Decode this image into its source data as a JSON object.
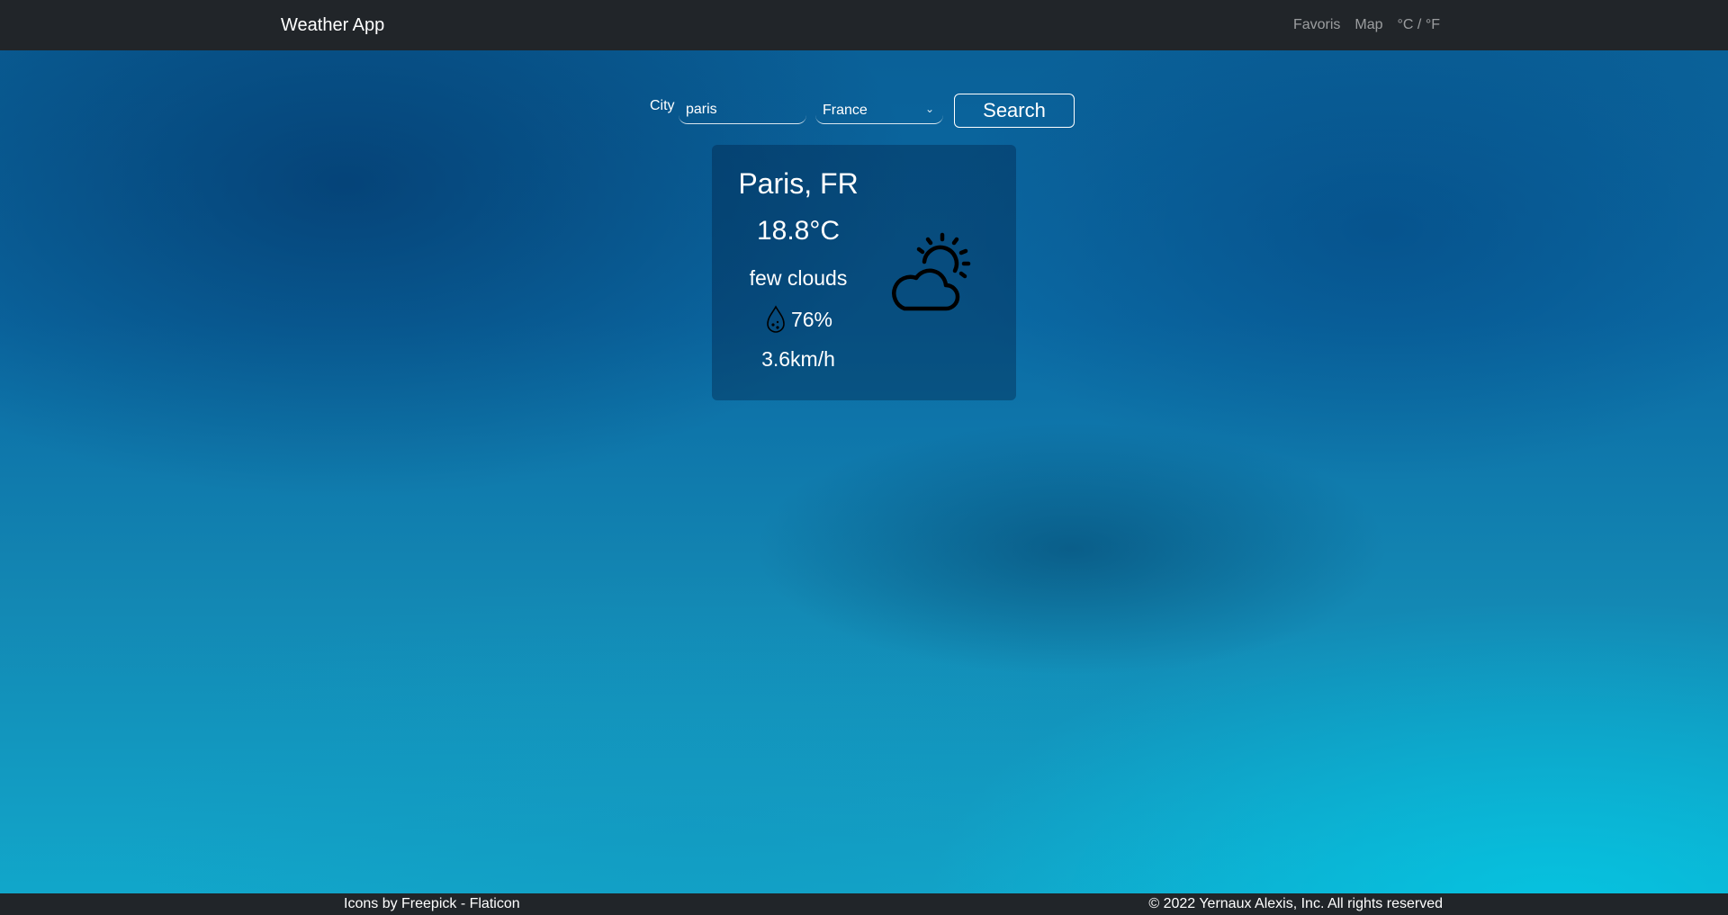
{
  "navbar": {
    "brand": "Weather App",
    "links": [
      "Favoris",
      "Map",
      "°C / °F"
    ]
  },
  "search": {
    "city_label": "City",
    "city_value": "paris",
    "country_selected": "France",
    "button_label": "Search"
  },
  "weather": {
    "city": "Paris, FR",
    "temperature": "18.8°C",
    "description": "few clouds",
    "humidity": "76%",
    "wind": "3.6km/h",
    "condition_icon": "partly-cloudy-icon",
    "humidity_icon": "water-drop-icon"
  },
  "footer": {
    "credit": "Icons by Freepick - Flaticon",
    "copyright": "© 2022 Yernaux Alexis, Inc. All rights reserved"
  },
  "colors": {
    "navbar_bg": "#212529",
    "text": "#ffffff",
    "nav_link": "rgba(255,255,255,0.55)"
  }
}
